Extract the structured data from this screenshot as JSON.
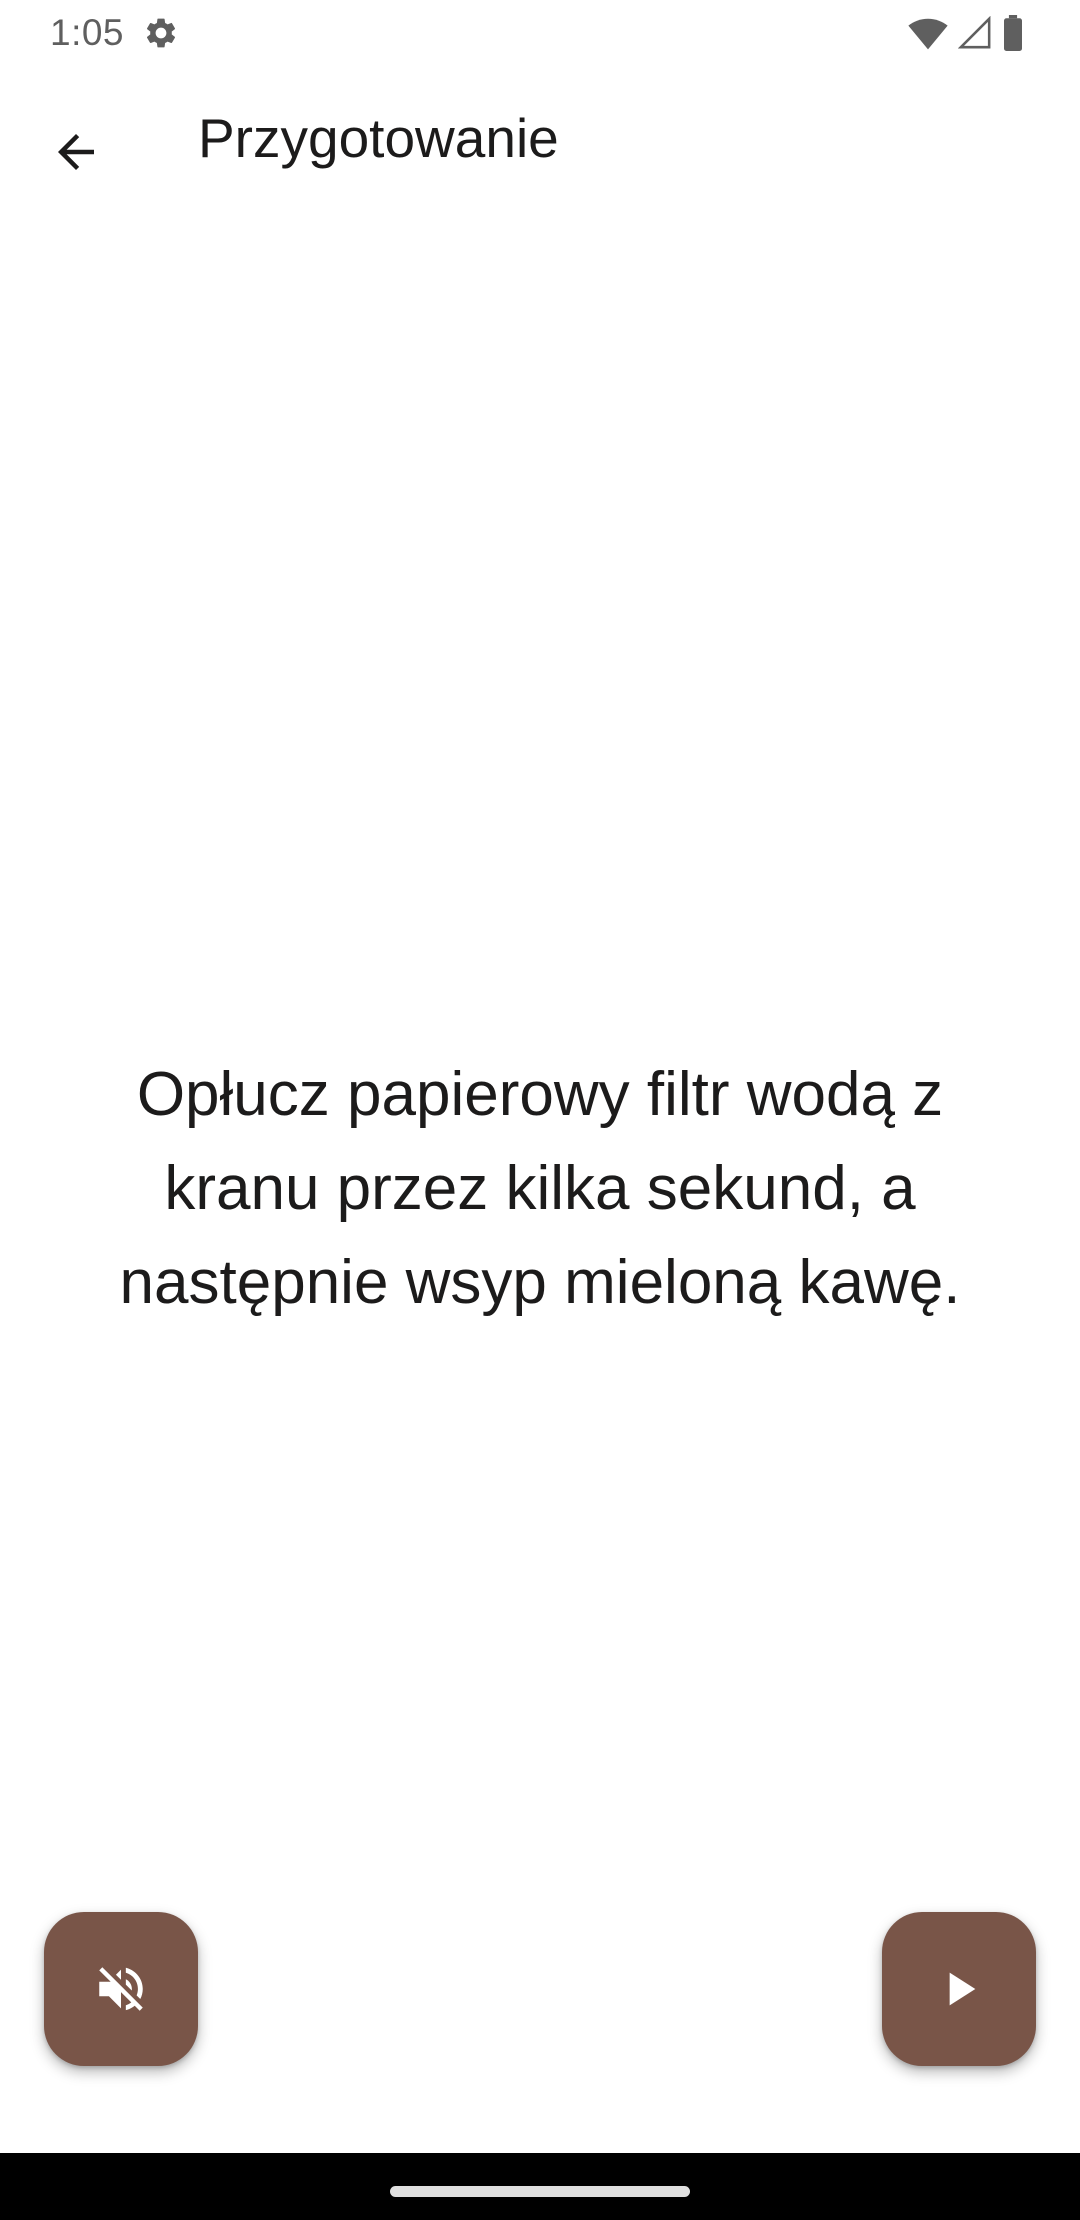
{
  "status_bar": {
    "time": "1:05",
    "icons": [
      "gear-icon",
      "wifi-icon",
      "signal-icon",
      "battery-icon"
    ]
  },
  "app_bar": {
    "back_icon": "arrow-back-icon",
    "title": "Przygotowanie"
  },
  "instruction": {
    "text": "Opłucz papierowy filtr wodą z kranu przez kilka sekund, a następnie wsyp mieloną kawę."
  },
  "fabs": {
    "mute_icon": "volume-off-icon",
    "play_icon": "play-icon"
  },
  "colors": {
    "fab_background": "#795548",
    "text_primary": "#1c1b1b",
    "status_text": "#5f5f5f",
    "nav_bar": "#000000"
  }
}
